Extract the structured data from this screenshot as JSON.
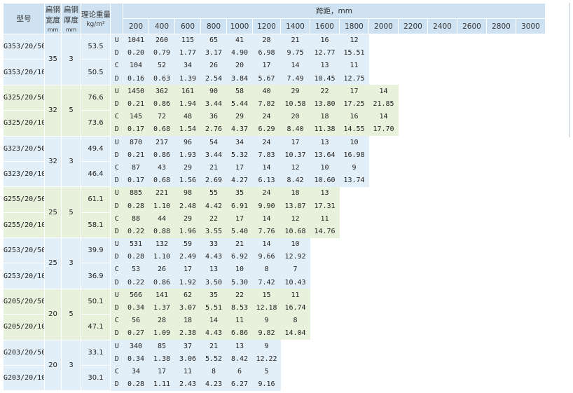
{
  "headers": {
    "model": "型号",
    "flat_width": [
      "扁钢",
      "宽度",
      "mm"
    ],
    "flat_thickness": [
      "扁钢",
      "厚度",
      "mm"
    ],
    "weight": [
      "理论重量",
      "kg/m²"
    ],
    "span": "跨距，mm",
    "spans": [
      "200",
      "400",
      "600",
      "800",
      "1000",
      "1200",
      "1400",
      "1600",
      "1800",
      "2000",
      "2200",
      "2400",
      "2600",
      "2800",
      "3000"
    ]
  },
  "groups": [
    {
      "color": "blue",
      "width": "35",
      "thickness": "3",
      "models": [
        {
          "name": "G353/20/50W",
          "weight": "53.5",
          "U": [
            "1041",
            "260",
            "115",
            "65",
            "41",
            "28",
            "21",
            "16",
            "12"
          ],
          "D": [
            "0.20",
            "0.79",
            "1.77",
            "3.17",
            "4.90",
            "6.98",
            "9.75",
            "12.77",
            "15.51"
          ]
        },
        {
          "name": "G353/20/100W",
          "weight": "50.5",
          "C": [
            "104",
            "52",
            "34",
            "26",
            "20",
            "17",
            "14",
            "13",
            "11"
          ],
          "D": [
            "0.16",
            "0.63",
            "1.39",
            "2.54",
            "3.84",
            "5.67",
            "7.49",
            "10.45",
            "12.75"
          ]
        }
      ]
    },
    {
      "color": "green",
      "width": "32",
      "thickness": "5",
      "models": [
        {
          "name": "G325/20/50W",
          "weight": "76.6",
          "U": [
            "1450",
            "362",
            "161",
            "90",
            "58",
            "40",
            "29",
            "22",
            "17",
            "14"
          ],
          "D": [
            "0.21",
            "0.86",
            "1.94",
            "3.44",
            "5.44",
            "7.82",
            "10.58",
            "13.80",
            "17.25",
            "21.85"
          ]
        },
        {
          "name": "G325/20/100W",
          "weight": "73.6",
          "C": [
            "145",
            "72",
            "48",
            "36",
            "29",
            "24",
            "20",
            "18",
            "16",
            "14"
          ],
          "D": [
            "0.17",
            "0.68",
            "1.54",
            "2.76",
            "4.37",
            "6.29",
            "8.40",
            "11.38",
            "14.55",
            "17.70"
          ]
        }
      ]
    },
    {
      "color": "blue",
      "width": "32",
      "thickness": "3",
      "models": [
        {
          "name": "G323/20/50W",
          "weight": "49.4",
          "U": [
            "870",
            "217",
            "96",
            "54",
            "34",
            "24",
            "17",
            "13",
            "10"
          ],
          "D": [
            "0.21",
            "0.86",
            "1.93",
            "3.44",
            "5.32",
            "7.83",
            "10.37",
            "13.64",
            "16.98"
          ]
        },
        {
          "name": "G323/20/100W",
          "weight": "46.4",
          "C": [
            "87",
            "43",
            "29",
            "21",
            "17",
            "14",
            "12",
            "10",
            "9"
          ],
          "D": [
            "0.17",
            "0.68",
            "1.56",
            "2.69",
            "4.27",
            "6.13",
            "8.42",
            "10.60",
            "13.74"
          ]
        }
      ]
    },
    {
      "color": "green",
      "width": "25",
      "thickness": "5",
      "models": [
        {
          "name": "G255/20/50W",
          "weight": "61.1",
          "U": [
            "885",
            "221",
            "98",
            "55",
            "35",
            "24",
            "18",
            "13"
          ],
          "D": [
            "0.28",
            "1.10",
            "2.48",
            "4.42",
            "6.91",
            "9.90",
            "13.87",
            "17.31"
          ]
        },
        {
          "name": "G255/20/100W",
          "weight": "58.1",
          "C": [
            "88",
            "44",
            "29",
            "22",
            "17",
            "14",
            "12",
            "11"
          ],
          "D": [
            "0.22",
            "0.88",
            "1.96",
            "3.55",
            "5.40",
            "7.76",
            "10.68",
            "14.76"
          ]
        }
      ]
    },
    {
      "color": "blue",
      "width": "25",
      "thickness": "3",
      "models": [
        {
          "name": "G253/20/50W",
          "weight": "39.9",
          "U": [
            "531",
            "132",
            "59",
            "33",
            "21",
            "14",
            "10"
          ],
          "D": [
            "0.28",
            "1.10",
            "2.49",
            "4.43",
            "6.92",
            "9.66",
            "12.92"
          ]
        },
        {
          "name": "G253/20/100W",
          "weight": "36.9",
          "C": [
            "53",
            "26",
            "17",
            "13",
            "10",
            "8",
            "7"
          ],
          "D": [
            "0.22",
            "0.86",
            "1.92",
            "3.50",
            "5.30",
            "7.42",
            "10.43"
          ]
        }
      ]
    },
    {
      "color": "green",
      "width": "20",
      "thickness": "5",
      "models": [
        {
          "name": "G205/20/50W",
          "weight": "50.1",
          "U": [
            "566",
            "141",
            "62",
            "35",
            "22",
            "15",
            "11"
          ],
          "D": [
            "0.34",
            "1.37",
            "3.07",
            "5.51",
            "8.53",
            "12.18",
            "16.74"
          ]
        },
        {
          "name": "G205/20/100W",
          "weight": "47.1",
          "C": [
            "56",
            "28",
            "18",
            "14",
            "11",
            "9",
            "8"
          ],
          "D": [
            "0.27",
            "1.09",
            "2.38",
            "4.43",
            "6.86",
            "9.82",
            "14.04"
          ]
        }
      ]
    },
    {
      "color": "blue",
      "width": "20",
      "thickness": "3",
      "models": [
        {
          "name": "G203/20/50W",
          "weight": "33.1",
          "U": [
            "340",
            "85",
            "37",
            "21",
            "13",
            "9"
          ],
          "D": [
            "0.34",
            "1.38",
            "3.06",
            "5.52",
            "8.42",
            "12.22"
          ]
        },
        {
          "name": "G203/20/100W",
          "weight": "30.1",
          "C": [
            "34",
            "17",
            "11",
            "8",
            "6",
            "5"
          ],
          "D": [
            "0.28",
            "1.11",
            "2.43",
            "4.23",
            "6.27",
            "9.16"
          ]
        }
      ]
    }
  ]
}
